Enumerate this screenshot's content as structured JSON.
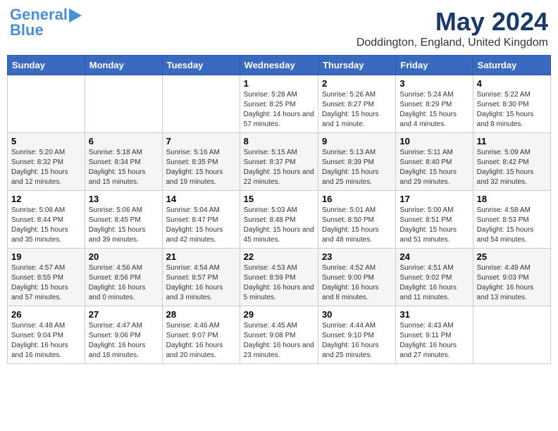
{
  "logo": {
    "text1": "General",
    "text2": "Blue"
  },
  "title": "May 2024",
  "location": "Doddington, England, United Kingdom",
  "days_of_week": [
    "Sunday",
    "Monday",
    "Tuesday",
    "Wednesday",
    "Thursday",
    "Friday",
    "Saturday"
  ],
  "weeks": [
    [
      {
        "day": "",
        "sunrise": "",
        "sunset": "",
        "daylight": ""
      },
      {
        "day": "",
        "sunrise": "",
        "sunset": "",
        "daylight": ""
      },
      {
        "day": "",
        "sunrise": "",
        "sunset": "",
        "daylight": ""
      },
      {
        "day": "1",
        "sunrise": "Sunrise: 5:28 AM",
        "sunset": "Sunset: 8:25 PM",
        "daylight": "Daylight: 14 hours and 57 minutes."
      },
      {
        "day": "2",
        "sunrise": "Sunrise: 5:26 AM",
        "sunset": "Sunset: 8:27 PM",
        "daylight": "Daylight: 15 hours and 1 minute."
      },
      {
        "day": "3",
        "sunrise": "Sunrise: 5:24 AM",
        "sunset": "Sunset: 8:29 PM",
        "daylight": "Daylight: 15 hours and 4 minutes."
      },
      {
        "day": "4",
        "sunrise": "Sunrise: 5:22 AM",
        "sunset": "Sunset: 8:30 PM",
        "daylight": "Daylight: 15 hours and 8 minutes."
      }
    ],
    [
      {
        "day": "5",
        "sunrise": "Sunrise: 5:20 AM",
        "sunset": "Sunset: 8:32 PM",
        "daylight": "Daylight: 15 hours and 12 minutes."
      },
      {
        "day": "6",
        "sunrise": "Sunrise: 5:18 AM",
        "sunset": "Sunset: 8:34 PM",
        "daylight": "Daylight: 15 hours and 15 minutes."
      },
      {
        "day": "7",
        "sunrise": "Sunrise: 5:16 AM",
        "sunset": "Sunset: 8:35 PM",
        "daylight": "Daylight: 15 hours and 19 minutes."
      },
      {
        "day": "8",
        "sunrise": "Sunrise: 5:15 AM",
        "sunset": "Sunset: 8:37 PM",
        "daylight": "Daylight: 15 hours and 22 minutes."
      },
      {
        "day": "9",
        "sunrise": "Sunrise: 5:13 AM",
        "sunset": "Sunset: 8:39 PM",
        "daylight": "Daylight: 15 hours and 25 minutes."
      },
      {
        "day": "10",
        "sunrise": "Sunrise: 5:11 AM",
        "sunset": "Sunset: 8:40 PM",
        "daylight": "Daylight: 15 hours and 29 minutes."
      },
      {
        "day": "11",
        "sunrise": "Sunrise: 5:09 AM",
        "sunset": "Sunset: 8:42 PM",
        "daylight": "Daylight: 15 hours and 32 minutes."
      }
    ],
    [
      {
        "day": "12",
        "sunrise": "Sunrise: 5:08 AM",
        "sunset": "Sunset: 8:44 PM",
        "daylight": "Daylight: 15 hours and 35 minutes."
      },
      {
        "day": "13",
        "sunrise": "Sunrise: 5:06 AM",
        "sunset": "Sunset: 8:45 PM",
        "daylight": "Daylight: 15 hours and 39 minutes."
      },
      {
        "day": "14",
        "sunrise": "Sunrise: 5:04 AM",
        "sunset": "Sunset: 8:47 PM",
        "daylight": "Daylight: 15 hours and 42 minutes."
      },
      {
        "day": "15",
        "sunrise": "Sunrise: 5:03 AM",
        "sunset": "Sunset: 8:48 PM",
        "daylight": "Daylight: 15 hours and 45 minutes."
      },
      {
        "day": "16",
        "sunrise": "Sunrise: 5:01 AM",
        "sunset": "Sunset: 8:50 PM",
        "daylight": "Daylight: 15 hours and 48 minutes."
      },
      {
        "day": "17",
        "sunrise": "Sunrise: 5:00 AM",
        "sunset": "Sunset: 8:51 PM",
        "daylight": "Daylight: 15 hours and 51 minutes."
      },
      {
        "day": "18",
        "sunrise": "Sunrise: 4:58 AM",
        "sunset": "Sunset: 8:53 PM",
        "daylight": "Daylight: 15 hours and 54 minutes."
      }
    ],
    [
      {
        "day": "19",
        "sunrise": "Sunrise: 4:57 AM",
        "sunset": "Sunset: 8:55 PM",
        "daylight": "Daylight: 15 hours and 57 minutes."
      },
      {
        "day": "20",
        "sunrise": "Sunrise: 4:56 AM",
        "sunset": "Sunset: 8:56 PM",
        "daylight": "Daylight: 16 hours and 0 minutes."
      },
      {
        "day": "21",
        "sunrise": "Sunrise: 4:54 AM",
        "sunset": "Sunset: 8:57 PM",
        "daylight": "Daylight: 16 hours and 3 minutes."
      },
      {
        "day": "22",
        "sunrise": "Sunrise: 4:53 AM",
        "sunset": "Sunset: 8:59 PM",
        "daylight": "Daylight: 16 hours and 5 minutes."
      },
      {
        "day": "23",
        "sunrise": "Sunrise: 4:52 AM",
        "sunset": "Sunset: 9:00 PM",
        "daylight": "Daylight: 16 hours and 8 minutes."
      },
      {
        "day": "24",
        "sunrise": "Sunrise: 4:51 AM",
        "sunset": "Sunset: 9:02 PM",
        "daylight": "Daylight: 16 hours and 11 minutes."
      },
      {
        "day": "25",
        "sunrise": "Sunrise: 4:49 AM",
        "sunset": "Sunset: 9:03 PM",
        "daylight": "Daylight: 16 hours and 13 minutes."
      }
    ],
    [
      {
        "day": "26",
        "sunrise": "Sunrise: 4:48 AM",
        "sunset": "Sunset: 9:04 PM",
        "daylight": "Daylight: 16 hours and 16 minutes."
      },
      {
        "day": "27",
        "sunrise": "Sunrise: 4:47 AM",
        "sunset": "Sunset: 9:06 PM",
        "daylight": "Daylight: 16 hours and 18 minutes."
      },
      {
        "day": "28",
        "sunrise": "Sunrise: 4:46 AM",
        "sunset": "Sunset: 9:07 PM",
        "daylight": "Daylight: 16 hours and 20 minutes."
      },
      {
        "day": "29",
        "sunrise": "Sunrise: 4:45 AM",
        "sunset": "Sunset: 9:08 PM",
        "daylight": "Daylight: 16 hours and 23 minutes."
      },
      {
        "day": "30",
        "sunrise": "Sunrise: 4:44 AM",
        "sunset": "Sunset: 9:10 PM",
        "daylight": "Daylight: 16 hours and 25 minutes."
      },
      {
        "day": "31",
        "sunrise": "Sunrise: 4:43 AM",
        "sunset": "Sunset: 9:11 PM",
        "daylight": "Daylight: 16 hours and 27 minutes."
      },
      {
        "day": "",
        "sunrise": "",
        "sunset": "",
        "daylight": ""
      }
    ]
  ]
}
